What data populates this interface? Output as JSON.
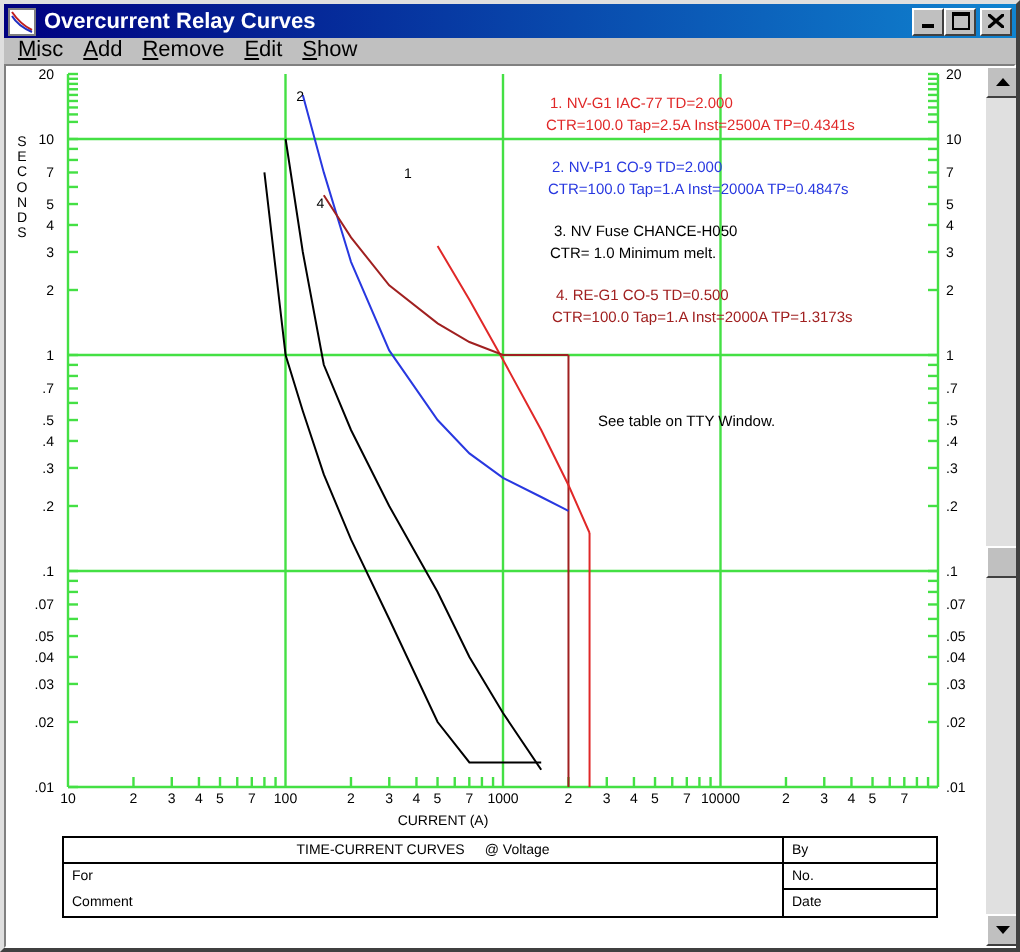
{
  "window": {
    "title": "Overcurrent Relay Curves"
  },
  "menu": [
    "Misc",
    "Add",
    "Remove",
    "Edit",
    "Show"
  ],
  "plot": {
    "y_axis_title": "SECONDS",
    "x_axis_title": "CURRENT (A)",
    "legend": [
      {
        "line1": "1.  NV-G1   IAC-77   TD=2.000",
        "line2": "CTR=100.0  Tap=2.5A Inst=2500A TP=0.4341s",
        "color": "#e02828"
      },
      {
        "line1": "2.  NV-P1   CO-9   TD=2.000",
        "line2": "CTR=100.0  Tap=1.A Inst=2000A TP=0.4847s",
        "color": "#2838e0"
      },
      {
        "line1": "3.  NV Fuse   CHANCE-H050",
        "line2": "CTR=   1.0 Minimum melt.",
        "color": "#000000"
      },
      {
        "line1": "4.  RE-G1   CO-5   TD=0.500",
        "line2": "CTR=100.0  Tap=1.A Inst=2000A TP=1.3173s",
        "color": "#a02020"
      }
    ],
    "note": "See table on TTY Window.",
    "curve_labels": [
      "1",
      "2",
      "4"
    ],
    "x_tick_labels": [
      "10",
      "2",
      "3",
      "4",
      "5",
      "7",
      "100",
      "2",
      "3",
      "4",
      "5",
      "7",
      "1000",
      "2",
      "3",
      "4",
      "5",
      "7",
      "10000",
      "2",
      "3",
      "4",
      "5",
      "7"
    ],
    "left_y_tick_labels": [
      "20",
      "10",
      "7",
      "5",
      "4",
      "3",
      "2",
      "1",
      ".7",
      ".5",
      ".4",
      ".3",
      ".2",
      ".1",
      ".07",
      ".05",
      ".04",
      ".03",
      ".02",
      ".01"
    ],
    "right_y_tick_labels": [
      "20",
      "10",
      "7",
      "5",
      "4",
      "3",
      "2",
      "1",
      ".7",
      ".5",
      ".4",
      ".3",
      ".2",
      ".1",
      ".07",
      ".05",
      ".04",
      ".03",
      ".02",
      ".01"
    ]
  },
  "title_block": {
    "title": "TIME-CURRENT CURVES",
    "voltage": "@ Voltage",
    "by": "By",
    "for": "For",
    "number": "No.",
    "comment": "Comment",
    "date": "Date"
  }
}
